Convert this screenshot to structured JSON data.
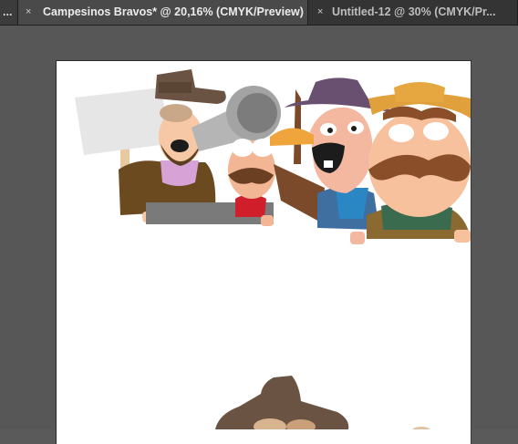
{
  "tabs": [
    {
      "label": "...",
      "close": ""
    },
    {
      "label": "Campesinos Bravos* @ 20,16% (CMYK/Preview)",
      "close": "×"
    },
    {
      "label": "Untitled-12 @ 30% (CMYK/Pr...",
      "close": "×"
    }
  ],
  "artwork": {
    "description_icon": "cartoon-illustration"
  },
  "colors": {
    "background": "#575757",
    "artboard": "#ffffff",
    "tabbar": "#333333"
  }
}
